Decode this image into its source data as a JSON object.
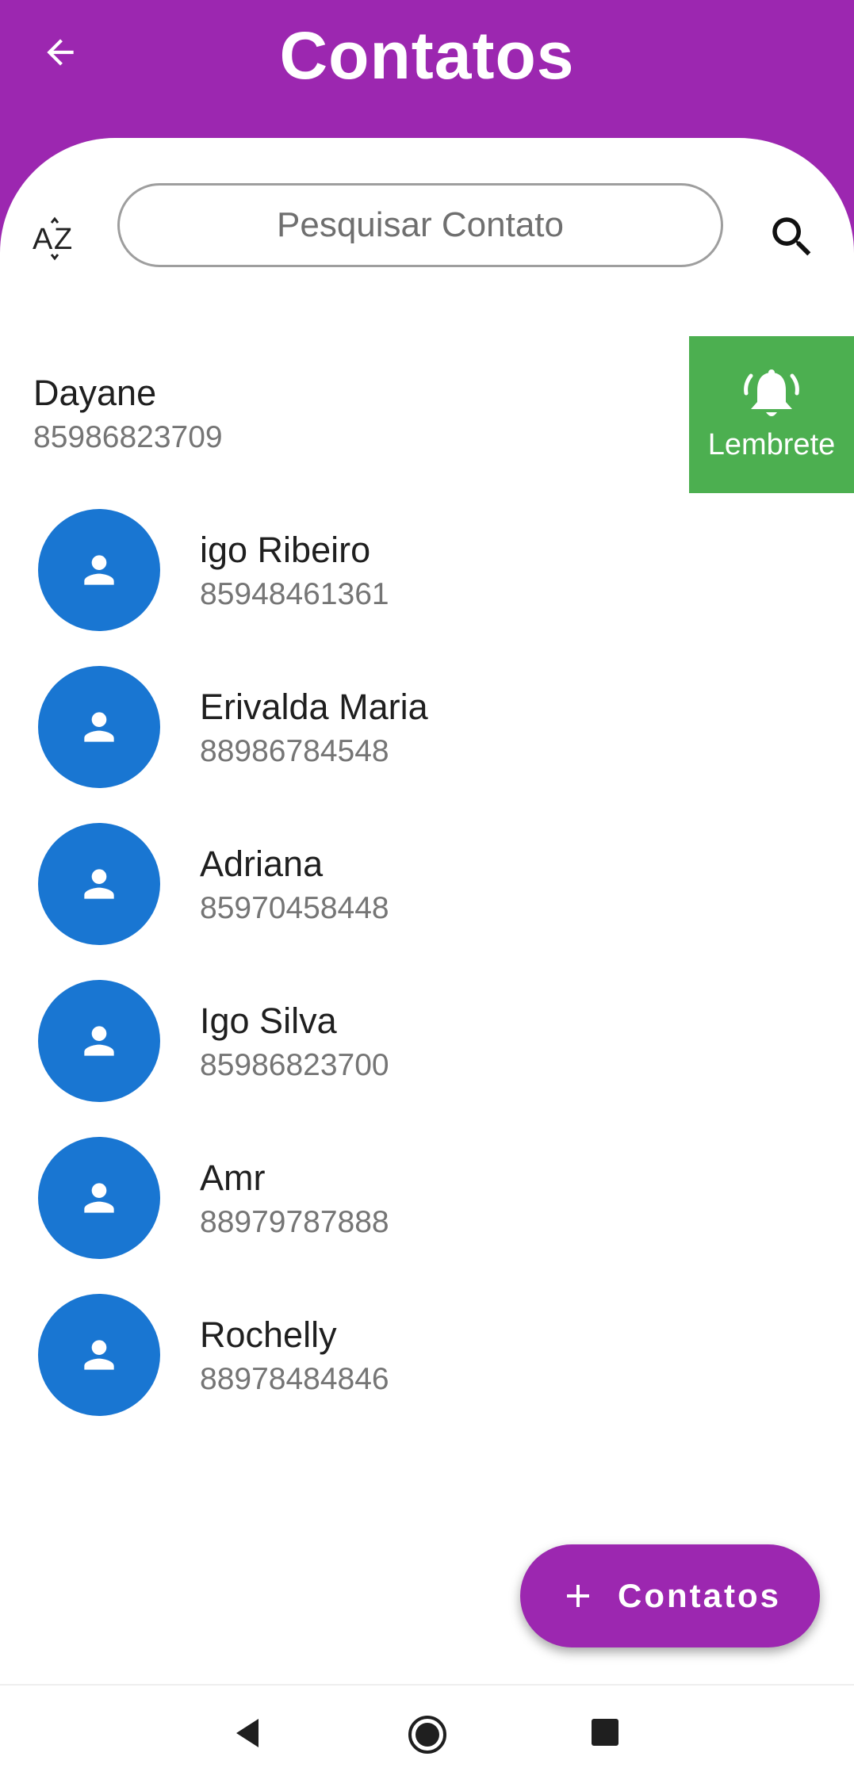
{
  "appbar": {
    "title": "Contatos",
    "back_icon": "arrow-left-icon",
    "background": "#9c27b0"
  },
  "search": {
    "placeholder": "Pesquisar Contato",
    "value": "",
    "sort_icon": "sort-alpha-icon",
    "sort_label": "AZ",
    "search_icon": "search-icon"
  },
  "swiped_contact": {
    "name": "Dayane",
    "phone": "85986823709",
    "action": {
      "label": "Lembrete",
      "icon": "bell-ring-icon",
      "color": "#4caf50"
    }
  },
  "contacts": [
    {
      "name": "igo Ribeiro",
      "phone": "85948461361"
    },
    {
      "name": "Erivalda Maria",
      "phone": "88986784548"
    },
    {
      "name": "Adriana",
      "phone": "85970458448"
    },
    {
      "name": "Igo Silva",
      "phone": "85986823700"
    },
    {
      "name": "Amr",
      "phone": "88979787888"
    },
    {
      "name": "Rochelly",
      "phone": "88978484846"
    }
  ],
  "avatar": {
    "icon": "person-icon",
    "color": "#1976d2"
  },
  "fab": {
    "label": "Contatos",
    "icon": "plus-icon"
  },
  "navbar": {
    "back": "nav-back-icon",
    "home": "nav-home-icon",
    "recent": "nav-recent-icon"
  }
}
